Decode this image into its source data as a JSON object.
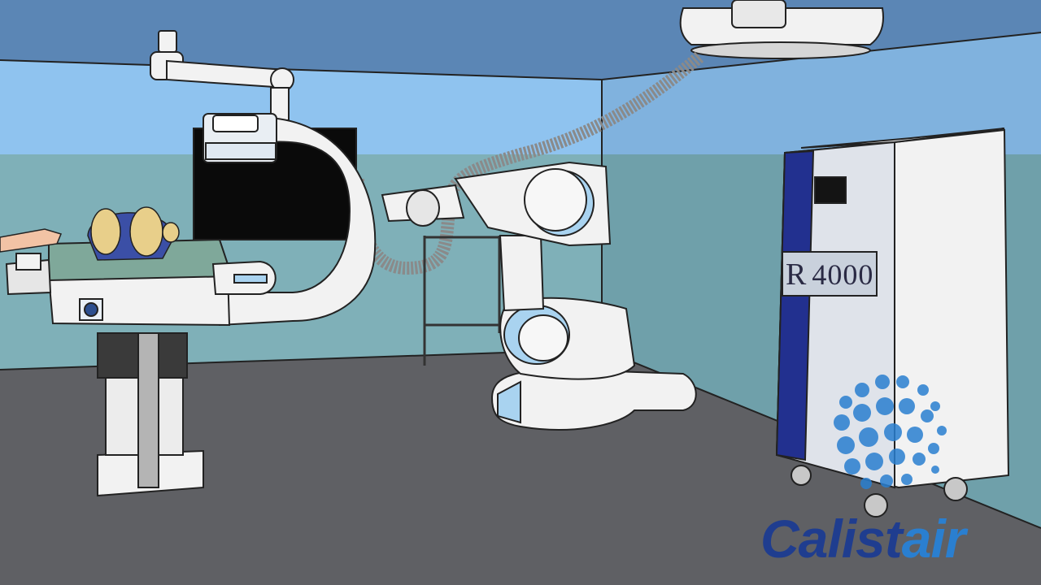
{
  "unit_label": {
    "prefix": "R",
    "number": "4000"
  },
  "brand": {
    "part1": "Calist",
    "part2": "air"
  },
  "colors": {
    "ceiling": "#5b86b5",
    "wall_upper": "#8fc3ef",
    "wall_lower": "#7fb0b8",
    "floor": "#5f6064",
    "machine_white": "#f2f2f2",
    "machine_blue": "#a9d3f0",
    "unit_stripe": "#22308f",
    "brand_dark": "#1f3d8f",
    "brand_light": "#2a7fd0"
  }
}
